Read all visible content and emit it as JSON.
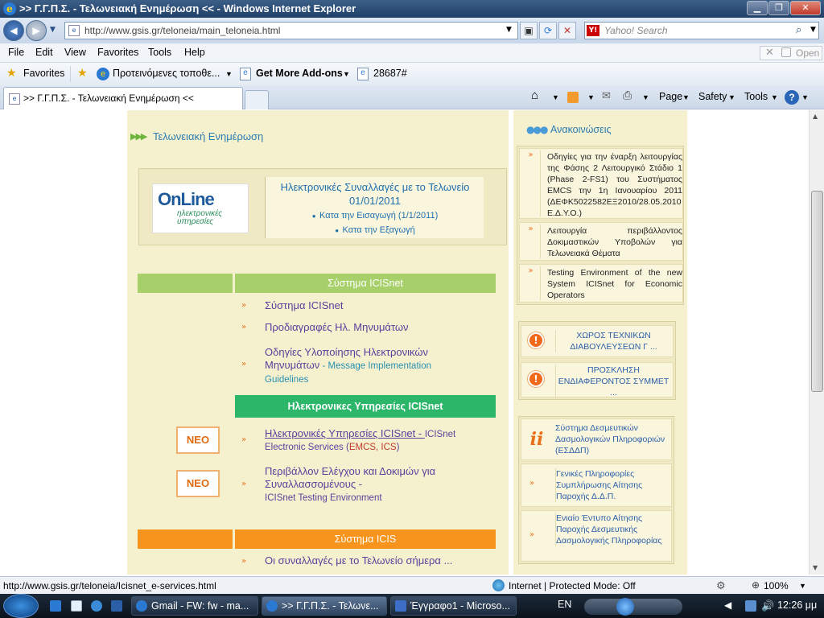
{
  "window": {
    "title": ">> Γ.Γ.Π.Σ. - Τελωνειακή Ενημέρωση << - Windows Internet Explorer"
  },
  "addressbar": {
    "url": "http://www.gsis.gr/teloneia/main_teloneia.html",
    "search_placeholder": "Yahoo! Search",
    "yahoo_icon": "Y!"
  },
  "menubar": {
    "items": [
      "File",
      "Edit",
      "View",
      "Favorites",
      "Tools",
      "Help"
    ],
    "open_label": "Open"
  },
  "favbar": {
    "favorites": "Favorites",
    "suggested": "Προτεινόμενες τοποθε...",
    "addons": "Get More Add-ons",
    "item": "28687#"
  },
  "tabs": {
    "active_label": ">> Γ.Γ.Π.Σ. - Τελωνειακή Ενημέρωση <<"
  },
  "commandbar": {
    "page": "Page",
    "safety": "Safety",
    "tools": "Tools"
  },
  "page": {
    "section_title": "Τελωνειακή Ενημέρωση",
    "online": {
      "logo_big": "OnLine",
      "logo_small": "ηλεκτρονικές υπηρεσίες",
      "heading": "Ηλεκτρονικές Συναλλαγές με το Τελωνείο 01/01/2011",
      "link1": "Κατα την Εισαγωγή (1/1/2011)",
      "link2": "Κατα την Εξαγωγή"
    },
    "band_icisnet": "Σύστημα ICISnet",
    "links_icisnet": [
      "Σύστημα ICISnet",
      "Προδιαγραφές Ηλ. Μηνυμάτων"
    ],
    "guidelines_main": "Οδηγίες Υλοποίησης Ηλεκτρονικών Μηνυμάτων",
    "guidelines_sub": " - Message Implementation Guidelines",
    "band_eservices": "Ηλεκτρονικες Υπηρεσίες ICISnet",
    "neo": "ΝΕΟ",
    "eservices_main": "Ηλεκτρονικές Υπηρεσίες ICISnet",
    "eservices_sub_a": " - ",
    "eservices_sub_b": "ICISnet Electronic Services (",
    "eservices_sub_c": "EMCS, ICS",
    "eservices_sub_d": ")",
    "testing_main": "Περιβάλλον Ελέγχου και Δοκιμών για Συναλλασσομένους",
    "testing_dash": " -",
    "testing_sub": "ICISnet Testing Environment",
    "band_icis": "Σύστημα ICIS",
    "icis_link": "Οι συναλλαγές με το Τελωνείο σήμερα ..."
  },
  "sidebar": {
    "title": "Ανακοινώσεις",
    "announcements": [
      "Οδηγίες για την έναρξη λειτουργίας της Φάσης 2 Λειτουργικό Στάδιο 1 (Phase 2-FS1) του Συστήματος EMCS την 1η Ιανουαρίου 2011 (ΔΕΦΚ5022582ΕΞ2010/28.05.2010 Ε.Δ.Υ.Ο.)",
      "Λειτουργία περιβάλλοντος Δοκιμαστικών Υποβολών για Τελωνειακά Θέματα",
      "Testing Environment of the new System ICISnet for Economic Operators"
    ],
    "notices": [
      "ΧΩΡΟΣ ΤΕΧΝΙΚΩΝ ΔΙΑΒΟΥΛΕΥΣΕΩΝ Γ ...",
      "ΠΡΟΣΚΛΗΣΗ ΕΝΔΙΑΦΕΡΟΝΤΟΣ ΣΥΜΜΕΤ ..."
    ],
    "info_links": [
      "Σύστημα Δεσμευτικών Δασμολογικών Πληροφοριών (ΕΣΔΔΠ)",
      "Γενικές Πληροφορίες Συμπλήρωσης Αίτησης Παροχής Δ.Δ.Π.",
      "Ενιαίο Έντυπο Αίτησης Παροχής Δεσμευτικής Δασμολογικής Πληροφορίας"
    ]
  },
  "statusbar": {
    "url": "http://www.gsis.gr/teloneia/Icisnet_e-services.html",
    "zone": "Internet | Protected Mode: Off",
    "zoom": "100%"
  },
  "taskbar": {
    "tasks": [
      "Gmail - FW: fw - ma...",
      ">> Γ.Γ.Π.Σ. - Τελωνε...",
      "Έγγραφο1 - Microso..."
    ],
    "lang": "EN",
    "time": "12:26 μμ"
  }
}
